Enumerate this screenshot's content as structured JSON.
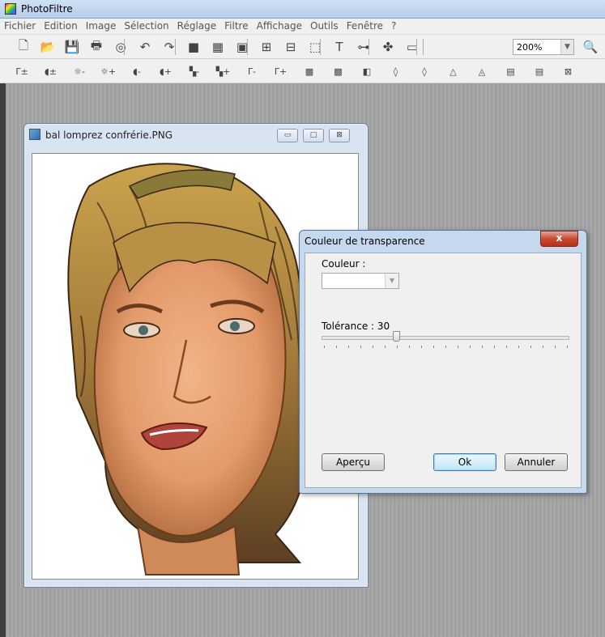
{
  "app": {
    "title": "PhotoFiltre"
  },
  "menu": [
    "Fichier",
    "Edition",
    "Image",
    "Sélection",
    "Réglage",
    "Filtre",
    "Affichage",
    "Outils",
    "Fenêtre",
    "?"
  ],
  "toolbar1": {
    "icons": [
      "new-file-icon",
      "open-folder-icon",
      "save-icon",
      "print-icon",
      "scanner-icon",
      "undo-icon",
      "redo-icon",
      "gray-square-icon",
      "color-grid-icon",
      "transparency-icon",
      "image-size-icon",
      "canvas-size-icon",
      "selection-icon",
      "text-icon",
      "layers-icon",
      "plugin-icon",
      "window-icon"
    ],
    "glyphs": [
      "🗋",
      "📂",
      "💾",
      "🖶",
      "◎",
      "↶",
      "↷",
      "■",
      "▦",
      "▣",
      "⊞",
      "⊟",
      "⬚",
      "T",
      "⊶",
      "✤",
      "▭"
    ],
    "zoom": "200%",
    "zoom_icon": "🔍"
  },
  "toolbar2": {
    "icons": [
      "gamma-auto-icon",
      "contrast-auto-icon",
      "brightness-minus-icon",
      "brightness-plus-icon",
      "contrast-minus-icon",
      "contrast-plus-icon",
      "saturation-minus-icon",
      "saturation-plus-icon",
      "gamma-minus-icon",
      "gamma-plus-icon",
      "grayscale-icon",
      "sepia-icon",
      "negative-icon",
      "blur-icon",
      "sharpen-icon",
      "soften-icon",
      "emboss-icon",
      "gradient-icon",
      "frame-icon",
      "mirror-icon"
    ],
    "glyphs": [
      "Γ±",
      "◖±",
      "☼-",
      "☼+",
      "◖-",
      "◖+",
      "▚-",
      "▚+",
      "Γ-",
      "Γ+",
      "▩",
      "▩",
      "◧",
      "◊",
      "◊",
      "△",
      "◬",
      "▤",
      "▤",
      "⊠"
    ]
  },
  "document": {
    "title": "bal lomprez confrérie.PNG",
    "minimize": "▭",
    "maximize": "□",
    "close": "⊠"
  },
  "dialog": {
    "title": "Couleur de transparence",
    "close": "x",
    "color_label": "Couleur :",
    "tolerance_label": "Tolérance : 30",
    "tolerance_value": 30,
    "tolerance_max": 100,
    "preview_button": "Aperçu",
    "ok_button": "Ok",
    "cancel_button": "Annuler"
  }
}
